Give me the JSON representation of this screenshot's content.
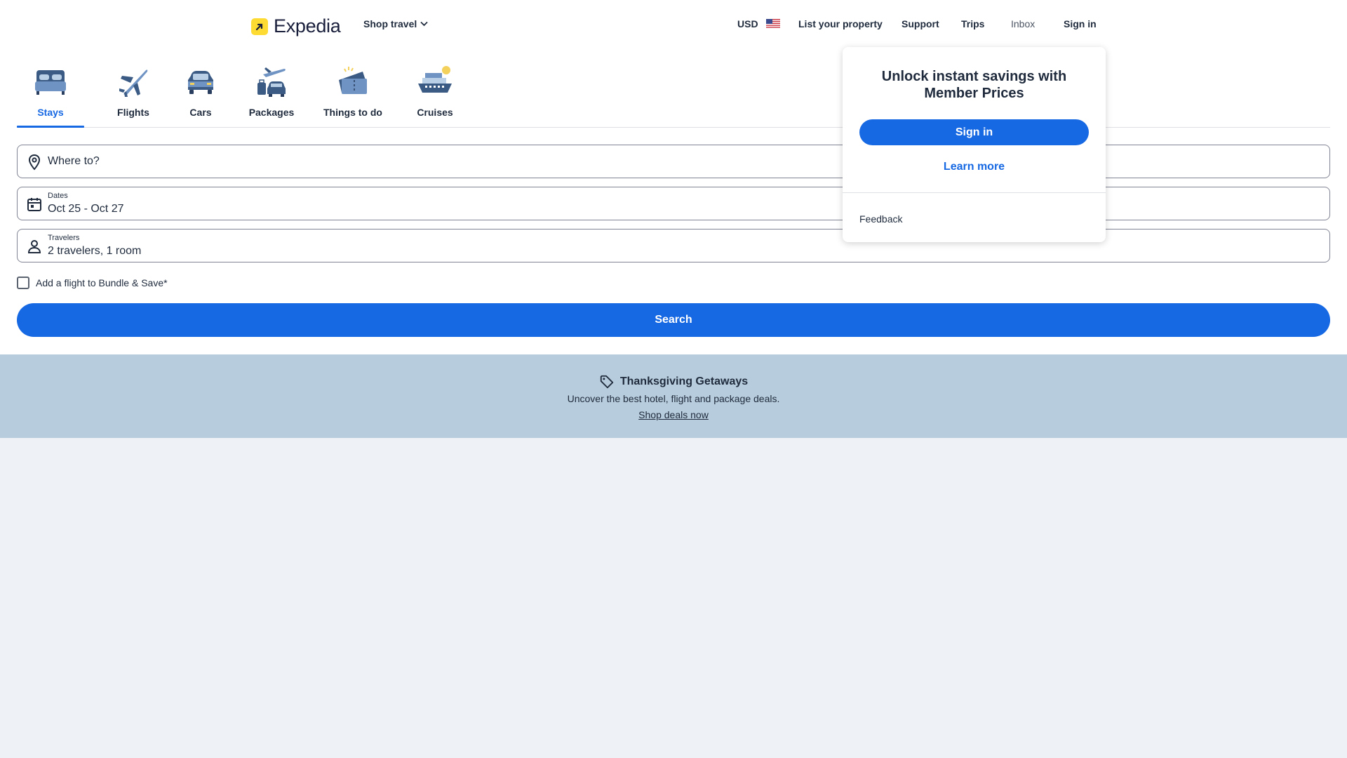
{
  "header": {
    "brand": "Expedia",
    "shop_travel": "Shop travel",
    "currency": "USD",
    "list_property": "List your property",
    "support": "Support",
    "trips": "Trips",
    "inbox": "Inbox",
    "sign_in": "Sign in"
  },
  "tabs": [
    {
      "label": "Stays",
      "icon": "bed-icon",
      "active": true
    },
    {
      "label": "Flights",
      "icon": "plane-icon",
      "active": false
    },
    {
      "label": "Cars",
      "icon": "car-icon",
      "active": false
    },
    {
      "label": "Packages",
      "icon": "packages-icon",
      "active": false
    },
    {
      "label": "Things to do",
      "icon": "ticket-icon",
      "active": false
    },
    {
      "label": "Cruises",
      "icon": "cruise-ship-icon",
      "active": false
    }
  ],
  "form": {
    "destination": {
      "placeholder": "Where to?"
    },
    "dates": {
      "label": "Dates",
      "value": "Oct 25 - Oct 27"
    },
    "travelers": {
      "label": "Travelers",
      "value": "2 travelers, 1 room"
    },
    "add_flight": {
      "label": "Add a flight to Bundle & Save*",
      "checked": false
    },
    "search_button": "Search"
  },
  "banner": {
    "title": "Thanksgiving Getaways",
    "subtitle": "Uncover the best hotel, flight and package deals.",
    "link": "Shop deals now"
  },
  "popover": {
    "title": "Unlock instant savings with Member Prices",
    "sign_in": "Sign in",
    "learn_more": "Learn more",
    "feedback": "Feedback"
  },
  "colors": {
    "primary": "#1668e3",
    "banner_bg": "#b7ccdc",
    "page_bg": "#eef2f7",
    "logo_yellow": "#fddb32"
  }
}
